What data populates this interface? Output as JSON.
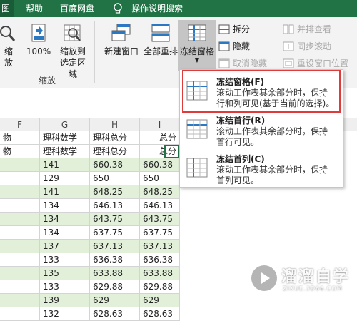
{
  "tabs": [
    "图",
    "帮助",
    "百度网盘",
    "操作说明搜索"
  ],
  "ribbon": {
    "zoom_btn": "缩放",
    "zoom100_btn": "100%",
    "zoom_sel_btn_l1": "缩放到",
    "zoom_sel_btn_l2": "选定区域",
    "zoom_group_label": "缩放",
    "new_window": "新建窗口",
    "arrange_all": "全部重排",
    "freeze_panes": "冻结窗格",
    "split": "拆分",
    "hide": "隐藏",
    "unhide": "取消隐藏",
    "side_by_side": "并排查看",
    "sync_scroll": "同步滚动",
    "reset_pos": "重设窗口位置"
  },
  "sheet": {
    "col_headers": [
      "F",
      "G",
      "H",
      "I"
    ],
    "header_row1": [
      "物",
      "理科数学",
      "理科总分",
      "总分"
    ],
    "header_row2": [
      "物",
      "理科数学",
      "理科总分",
      "总分"
    ],
    "rows": [
      [
        "141",
        "660.38",
        "660.38"
      ],
      [
        "129",
        "650",
        "650"
      ],
      [
        "141",
        "648.25",
        "648.25"
      ],
      [
        "134",
        "646.13",
        "646.13"
      ],
      [
        "134",
        "643.75",
        "643.75"
      ],
      [
        "134",
        "637.75",
        "637.75"
      ],
      [
        "137",
        "637.13",
        "637.13"
      ],
      [
        "133",
        "636.38",
        "636.38"
      ],
      [
        "135",
        "633.88",
        "633.88"
      ],
      [
        "133",
        "629.88",
        "629.88"
      ],
      [
        "139",
        "629",
        "629"
      ],
      [
        "132",
        "628.63",
        "628.63"
      ]
    ]
  },
  "menu": {
    "items": [
      {
        "title": "冻结窗格(F)",
        "desc1": "滚动工作表其余部分时，保持",
        "desc2": "行和列可见(基于当前的选择)。"
      },
      {
        "title": "冻结首行(R)",
        "desc1": "滚动工作表其余部分时，保持",
        "desc2": "首行可见。"
      },
      {
        "title": "冻结首列(C)",
        "desc1": "滚动工作表其余部分时，保持",
        "desc2": "首列可见。"
      }
    ]
  },
  "watermark": {
    "text": "溜溜自学",
    "sub": "ZIXUE.3D66.COM"
  },
  "colors": {
    "excel_green": "#217346",
    "highlight_row": "#e2f0d9",
    "red_box": "#e03b3b"
  }
}
